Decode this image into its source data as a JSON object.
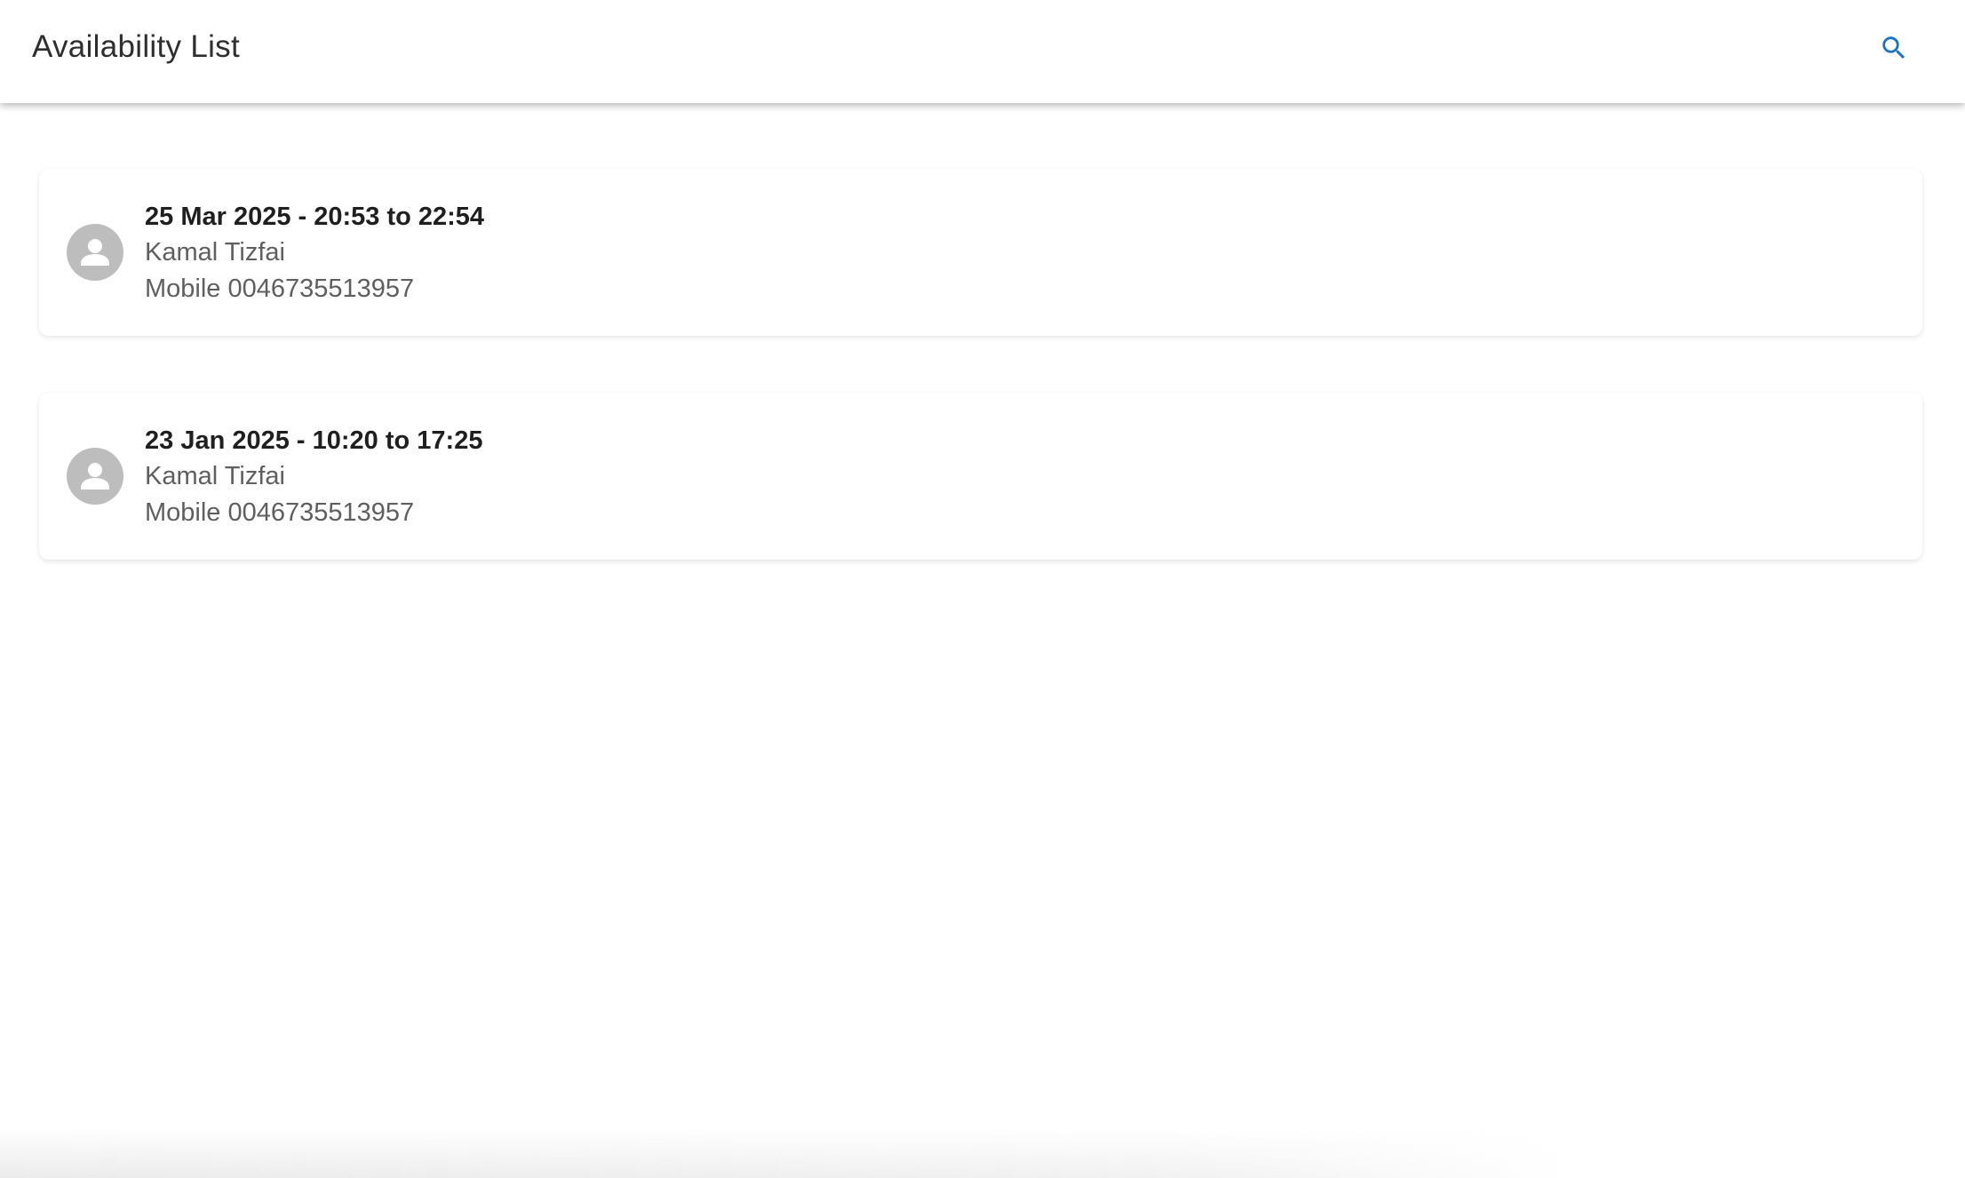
{
  "header": {
    "title": "Availability List",
    "search_icon": "search-icon",
    "accent_color": "#1a73c8"
  },
  "availability": [
    {
      "title": "25 Mar 2025 - 20:53 to 22:54",
      "name": "Kamal Tizfai",
      "phone": "Mobile 0046735513957",
      "avatar_icon": "person-icon"
    },
    {
      "title": "23 Jan 2025 - 10:20 to 17:25",
      "name": "Kamal Tizfai",
      "phone": "Mobile 0046735513957",
      "avatar_icon": "person-icon"
    }
  ]
}
